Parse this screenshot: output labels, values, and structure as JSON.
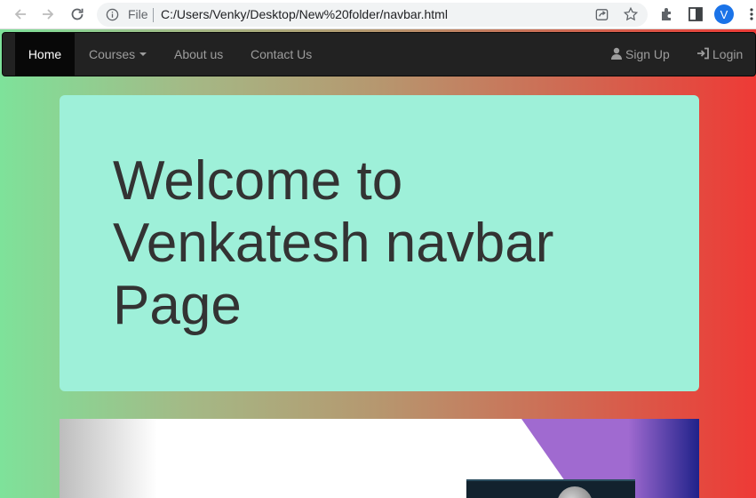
{
  "browser": {
    "scheme_label": "File",
    "url": "C:/Users/Venky/Desktop/New%20folder/navbar.html",
    "profile_initial": "V"
  },
  "navbar": {
    "home": "Home",
    "courses": "Courses",
    "about": "About us",
    "contact": "Contact Us",
    "signup": "Sign Up",
    "login": "Login"
  },
  "jumbotron": {
    "title": "Welcome to Venkatesh navbar Page"
  },
  "colors": {
    "gradient_start": "#7ee29a",
    "gradient_end": "#ee3a36",
    "jumbotron_bg": "#9ef0d9",
    "navbar_bg": "#222222"
  }
}
